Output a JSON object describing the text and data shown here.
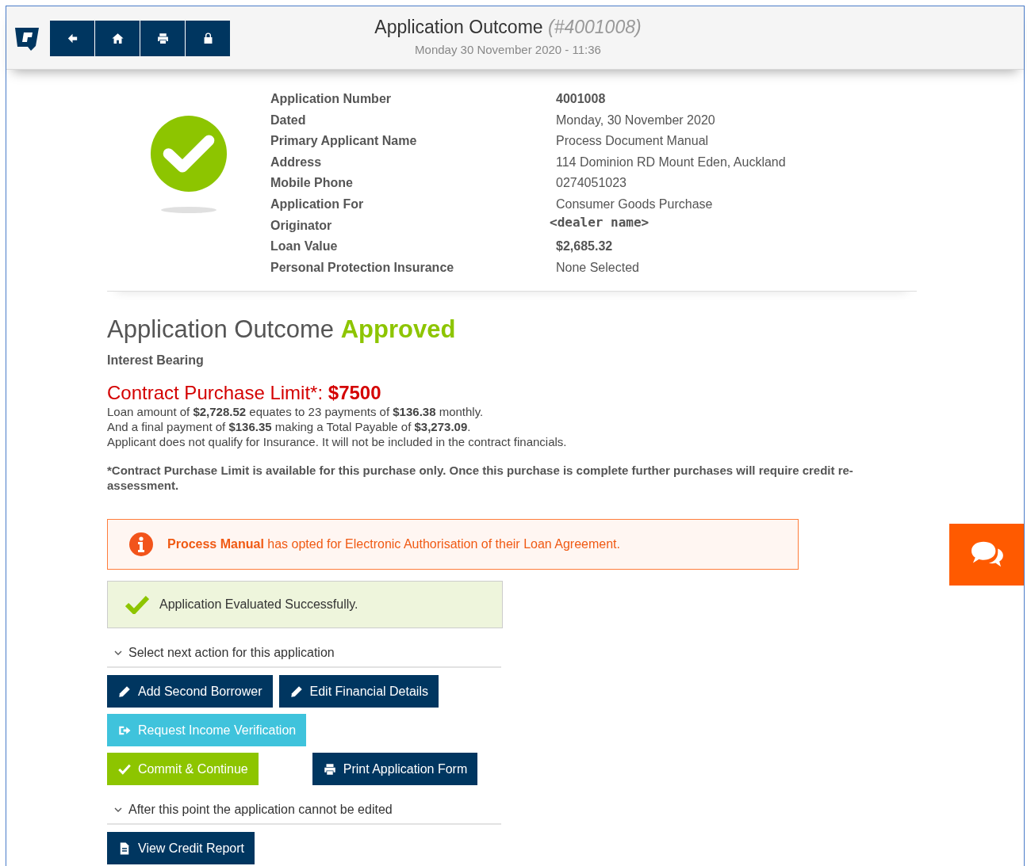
{
  "header": {
    "title": "Application Outcome",
    "reference": "(#4001008)",
    "subtitle": "Monday 30 November 2020 - 11:36"
  },
  "details": [
    {
      "label": "Application Number",
      "value": "4001008",
      "kind": "bold"
    },
    {
      "label": "Dated",
      "value": "Monday, 30 November 2020",
      "kind": "plain"
    },
    {
      "label": "Primary Applicant Name",
      "value": "Process Document Manual",
      "kind": "plain"
    },
    {
      "label": "Address",
      "value": "114 Dominion RD Mount Eden, Auckland",
      "kind": "plain"
    },
    {
      "label": "Mobile Phone",
      "value": "0274051023",
      "kind": "plain"
    },
    {
      "label": "Application For",
      "value": "Consumer Goods Purchase",
      "kind": "plain"
    },
    {
      "label": "Originator",
      "value": "<dealer name>",
      "kind": "mono"
    },
    {
      "label": "Loan Value",
      "value": "$2,685.32",
      "kind": "bold"
    },
    {
      "label": "Personal Protection Insurance",
      "value": "None Selected",
      "kind": "plain"
    }
  ],
  "outcome": {
    "title": "Application Outcome",
    "status": "Approved",
    "type": "Interest Bearing",
    "limit": "Contract Purchase Limit*: **$7500**",
    "lines": [
      "Loan amount of **$2,728.52** equates to 23 payments of **$136.38** monthly.",
      "And a final payment of **$136.35** making a Total Payable of **$3,273.09**.",
      "Applicant does not qualify for Insurance. It will not be included in the contract financials."
    ],
    "note": "*Contract Purchase Limit is available for this purchase only. Once this purchase is complete further purchases will require credit re-assessment."
  },
  "alert": "**Process Manual** has opted for Electronic Authorisation of their Loan Agreement.",
  "success": "Application Evaluated Successfully.",
  "sections": [
    {
      "heading": "Select next action for this application",
      "rows": [
        [
          {
            "label": "Add Second Borrower",
            "kind": "primary"
          },
          {
            "label": "Edit Financial Details",
            "kind": "primary"
          }
        ],
        [
          {
            "label": "Request Income Verification",
            "kind": "info"
          }
        ],
        [
          {
            "label": "Commit & Continue",
            "kind": "success"
          },
          {
            "label": "Print Application Form",
            "kind": "primary"
          }
        ]
      ]
    },
    {
      "heading": "After this point the application cannot be edited",
      "rows": [
        [
          {
            "label": "View Credit Report",
            "kind": "primary"
          }
        ]
      ]
    }
  ]
}
